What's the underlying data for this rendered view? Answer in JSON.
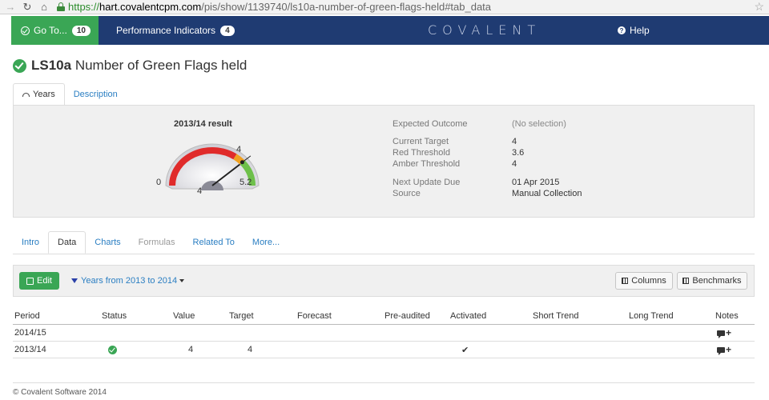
{
  "browser": {
    "url_https": "https://",
    "url_domain": "hart.covalentcpm.com",
    "url_path": "/pis/show/1139740/ls10a-number-of-green-flags-held#tab_data"
  },
  "topnav": {
    "goto_label": "Go To...",
    "goto_count": "10",
    "perf_label": "Performance Indicators",
    "perf_count": "4",
    "logo": "COVALENT",
    "help_label": "Help"
  },
  "page": {
    "code": "LS10a",
    "title": "Number of Green Flags held"
  },
  "top_tabs": [
    {
      "label": "Years",
      "active": true
    },
    {
      "label": "Description",
      "active": false
    }
  ],
  "years": {
    "result_label": "2013/14 result",
    "gauge": {
      "min_label": "0",
      "max_label": "5.2",
      "target_label": "4",
      "value_label": "4",
      "min": 0,
      "max": 5.2,
      "red_threshold": 3.6,
      "amber_threshold": 4,
      "value": 4,
      "colors": {
        "red": "#e02b2b",
        "amber": "#f0a020",
        "green": "#6ec04a"
      }
    },
    "info": [
      {
        "label": "Expected Outcome",
        "value": "(No selection)"
      },
      {
        "label": "Current Target",
        "value": "4"
      },
      {
        "label": "Red Threshold",
        "value": "3.6"
      },
      {
        "label": "Amber Threshold",
        "value": "4"
      },
      {
        "label": "Next Update Due",
        "value": "01 Apr 2015"
      },
      {
        "label": "Source",
        "value": "Manual Collection"
      }
    ]
  },
  "data_tabs": [
    {
      "label": "Intro"
    },
    {
      "label": "Data"
    },
    {
      "label": "Charts"
    },
    {
      "label": "Formulas"
    },
    {
      "label": "Related To"
    },
    {
      "label": "More..."
    }
  ],
  "toolbar": {
    "edit_label": "Edit",
    "filter_label": "Years from 2013 to 2014",
    "columns_label": "Columns",
    "benchmarks_label": "Benchmarks"
  },
  "table": {
    "headers": [
      "Period",
      "Status",
      "Value",
      "Target",
      "Forecast",
      "Pre-audited",
      "Activated",
      "Short Trend",
      "Long Trend",
      "Notes"
    ],
    "rows": [
      {
        "period": "2014/15",
        "status": "",
        "value": "",
        "target": "",
        "activated": ""
      },
      {
        "period": "2013/14",
        "status": "ok",
        "value": "4",
        "target": "4",
        "activated": "✔"
      }
    ]
  },
  "footer": "© Covalent Software 2014"
}
